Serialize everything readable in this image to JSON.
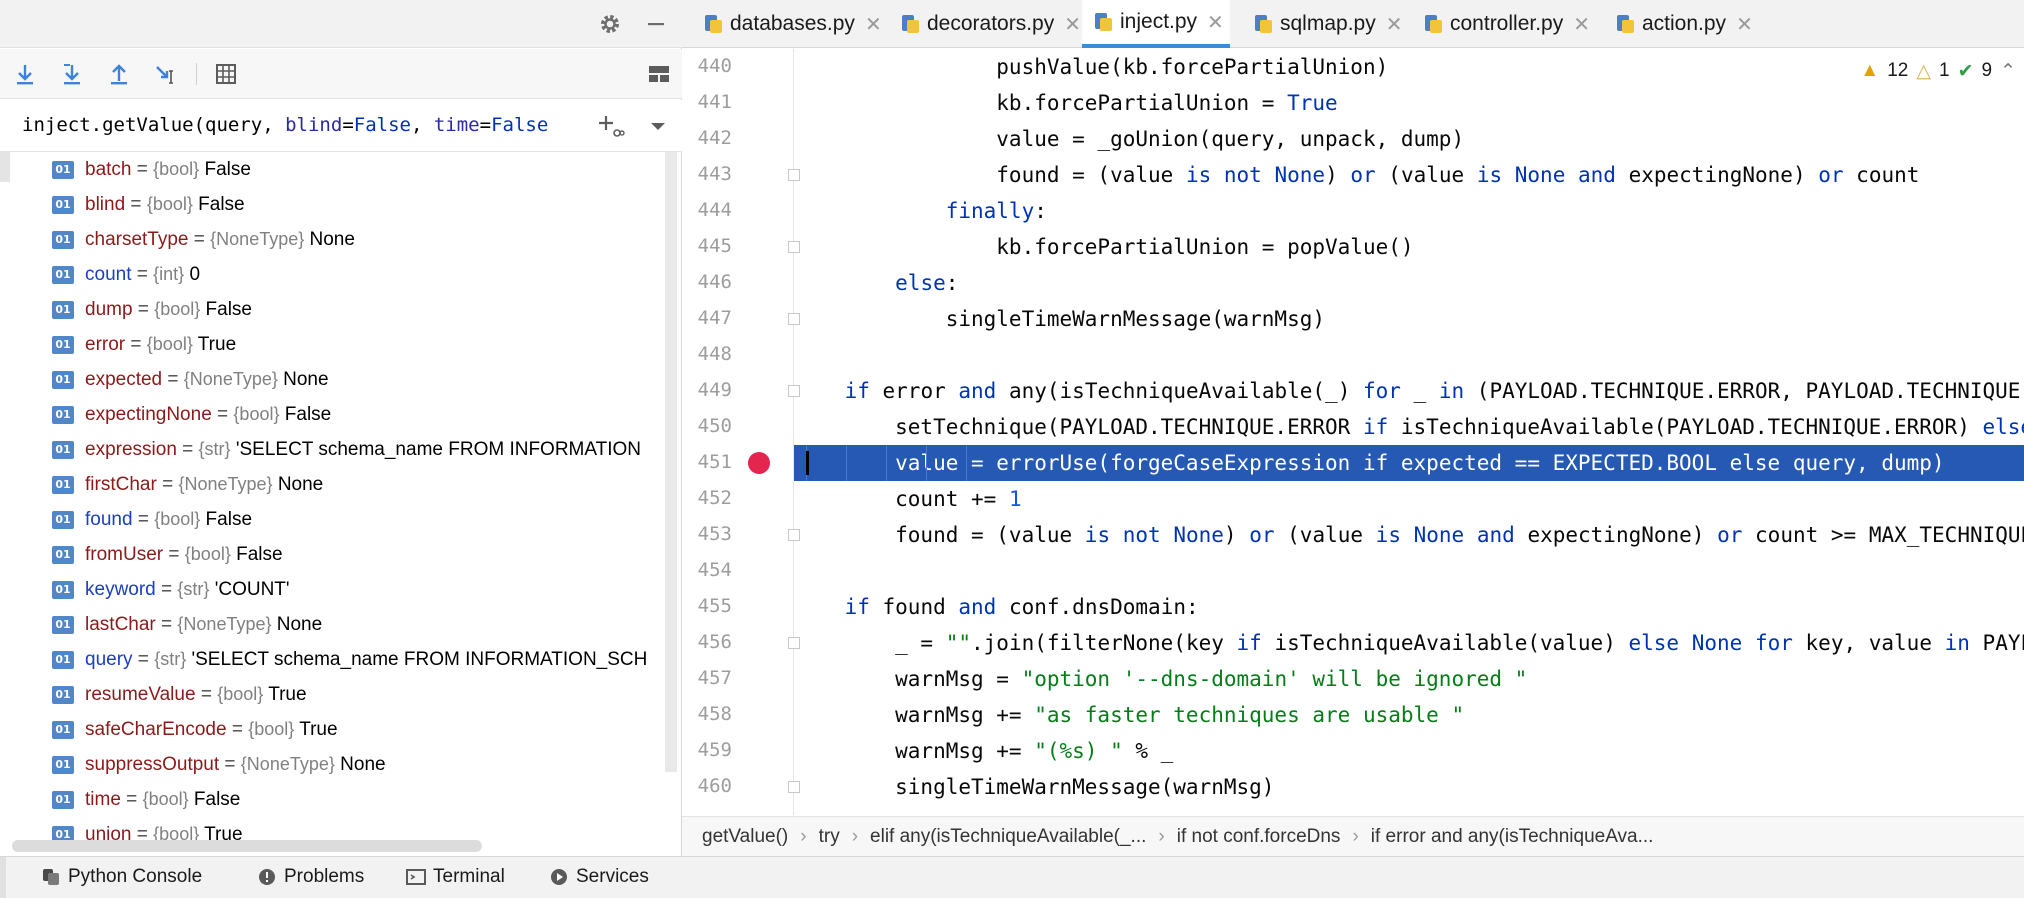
{
  "left_panel": {
    "frame": {
      "func": "inject.getValue(query, ",
      "p1_name": "blind",
      "p1_val": "False",
      "sep": ", ",
      "p2_name": "time",
      "p2_val": "False"
    },
    "variables": [
      {
        "name": "batch",
        "type": "{bool}",
        "value": "False",
        "color": "red"
      },
      {
        "name": "blind",
        "type": "{bool}",
        "value": "False",
        "color": "red"
      },
      {
        "name": "charsetType",
        "type": "{NoneType}",
        "value": "None",
        "color": "red"
      },
      {
        "name": "count",
        "type": "{int}",
        "value": "0",
        "color": "blue"
      },
      {
        "name": "dump",
        "type": "{bool}",
        "value": "False",
        "color": "red"
      },
      {
        "name": "error",
        "type": "{bool}",
        "value": "True",
        "color": "red"
      },
      {
        "name": "expected",
        "type": "{NoneType}",
        "value": "None",
        "color": "red"
      },
      {
        "name": "expectingNone",
        "type": "{bool}",
        "value": "False",
        "color": "red"
      },
      {
        "name": "expression",
        "type": "{str}",
        "value": "'SELECT schema_name FROM INFORMATION",
        "color": "red"
      },
      {
        "name": "firstChar",
        "type": "{NoneType}",
        "value": "None",
        "color": "red"
      },
      {
        "name": "found",
        "type": "{bool}",
        "value": "False",
        "color": "blue"
      },
      {
        "name": "fromUser",
        "type": "{bool}",
        "value": "False",
        "color": "red"
      },
      {
        "name": "keyword",
        "type": "{str}",
        "value": "'COUNT'",
        "color": "blue"
      },
      {
        "name": "lastChar",
        "type": "{NoneType}",
        "value": "None",
        "color": "red"
      },
      {
        "name": "query",
        "type": "{str}",
        "value": "'SELECT schema_name FROM INFORMATION_SCH",
        "color": "blue"
      },
      {
        "name": "resumeValue",
        "type": "{bool}",
        "value": "True",
        "color": "red"
      },
      {
        "name": "safeCharEncode",
        "type": "{bool}",
        "value": "True",
        "color": "red"
      },
      {
        "name": "suppressOutput",
        "type": "{NoneType}",
        "value": "None",
        "color": "red"
      },
      {
        "name": "time",
        "type": "{bool}",
        "value": "False",
        "color": "red"
      },
      {
        "name": "union",
        "type": "{bool}",
        "value": "True",
        "color": "red"
      }
    ]
  },
  "tabs": [
    {
      "label": "databases.py",
      "active": false
    },
    {
      "label": "decorators.py",
      "active": false
    },
    {
      "label": "inject.py",
      "active": true
    },
    {
      "label": "sqlmap.py",
      "active": false
    },
    {
      "label": "controller.py",
      "active": false
    },
    {
      "label": "action.py",
      "active": false
    }
  ],
  "inspections": {
    "warnings": "12",
    "weak_warnings": "1",
    "typos": "9"
  },
  "editor": {
    "lines": [
      {
        "no": "440",
        "code": "                pushValue(kb.forcePartialUnion)"
      },
      {
        "no": "441",
        "code": "                kb.forcePartialUnion = True"
      },
      {
        "no": "442",
        "code": "                value = _goUnion(query, unpack, dump)"
      },
      {
        "no": "443",
        "code": "                found = (value is not None) or (value is None and expectingNone) or count"
      },
      {
        "no": "444",
        "code": "            finally:"
      },
      {
        "no": "445",
        "code": "                kb.forcePartialUnion = popValue()"
      },
      {
        "no": "446",
        "code": "        else:"
      },
      {
        "no": "447",
        "code": "            singleTimeWarnMessage(warnMsg)"
      },
      {
        "no": "448",
        "code": ""
      },
      {
        "no": "449",
        "code": "    if error and any(isTechniqueAvailable(_) for _ in (PAYLOAD.TECHNIQUE.ERROR, PAYLOAD.TECHNIQUE.QUERY)) and not found:"
      },
      {
        "no": "450",
        "code": "        setTechnique(PAYLOAD.TECHNIQUE.ERROR if isTechniqueAvailable(PAYLOAD.TECHNIQUE.ERROR) else PAYLOAD.TECHNIQUE.QUERY)"
      },
      {
        "no": "451",
        "code": "        value = errorUse(forgeCaseExpression if expected == EXPECTED.BOOL else query, dump)"
      },
      {
        "no": "452",
        "code": "        count += 1"
      },
      {
        "no": "453",
        "code": "        found = (value is not None) or (value is None and expectingNone) or count >= MAX_TECHNIQUES_PER_VALUE"
      },
      {
        "no": "454",
        "code": ""
      },
      {
        "no": "455",
        "code": "    if found and conf.dnsDomain:"
      },
      {
        "no": "456",
        "code": "        _ = \"\".join(filterNone(key if isTechniqueAvailable(value) else None for key, value in PAYLOAD.SQLINJECTION.items()))"
      },
      {
        "no": "457",
        "code": "        warnMsg = \"option '--dns-domain' will be ignored \""
      },
      {
        "no": "458",
        "code": "        warnMsg += \"as faster techniques are usable \""
      },
      {
        "no": "459",
        "code": "        warnMsg += \"(%s) \" % _"
      },
      {
        "no": "460",
        "code": "        singleTimeWarnMessage(warnMsg)"
      }
    ],
    "breakpoint_line": "451"
  },
  "breadcrumb": [
    "getValue()",
    "try",
    "elif any(isTechniqueAvailable(_...",
    "if not conf.forceDns",
    "if error and any(isTechniqueAva..."
  ],
  "bottom_bar": [
    {
      "label": "Python Console",
      "icon": "python-icon"
    },
    {
      "label": "Problems",
      "icon": "problems-icon"
    },
    {
      "label": "Terminal",
      "icon": "terminal-icon"
    },
    {
      "label": "Services",
      "icon": "services-icon"
    }
  ]
}
